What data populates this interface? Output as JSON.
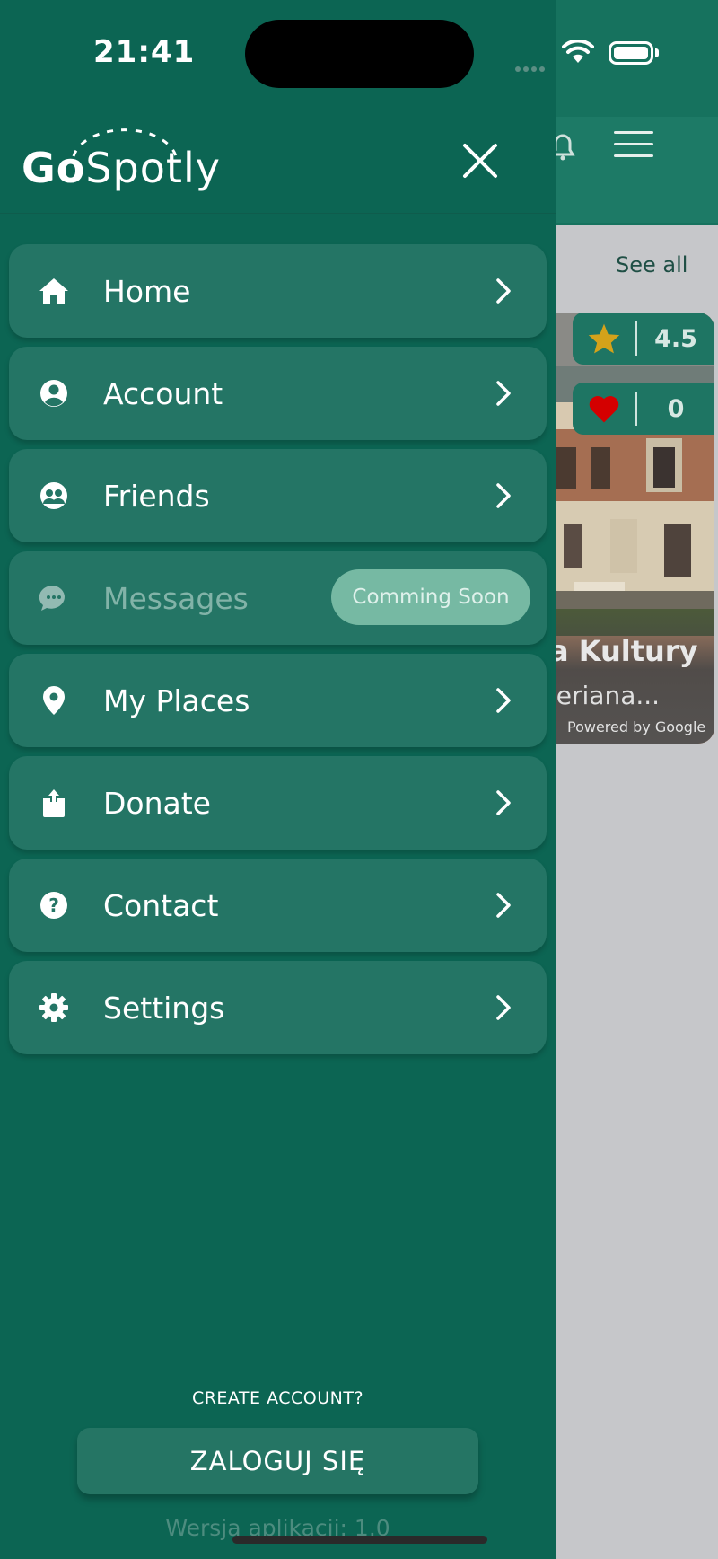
{
  "status_bar": {
    "time": "21:41"
  },
  "background_app": {
    "see_all": "See all",
    "card": {
      "rating": "4.5",
      "likes": "0",
      "title": "a Kultury",
      "subtitle": "leriana...",
      "attribution": "Powered by Google"
    }
  },
  "drawer": {
    "logo": {
      "part1": "Go",
      "part2": "Spotly"
    },
    "menu": [
      {
        "label": "Home",
        "icon": "home-icon"
      },
      {
        "label": "Account",
        "icon": "account-icon"
      },
      {
        "label": "Friends",
        "icon": "friends-icon"
      },
      {
        "label": "Messages",
        "icon": "messages-icon",
        "badge": "Comming Soon"
      },
      {
        "label": "My Places",
        "icon": "map-pin-icon"
      },
      {
        "label": "Donate",
        "icon": "share-icon"
      },
      {
        "label": "Contact",
        "icon": "help-icon"
      },
      {
        "label": "Settings",
        "icon": "gear-icon"
      }
    ],
    "create_account": "CREATE ACCOUNT?",
    "login_button": "ZALOGUJ SIĘ",
    "app_version": "Wersja aplikacji: 1.0"
  },
  "colors": {
    "drawer_bg": "#0c6553",
    "menu_item_bg": "#247565",
    "badge_bg": "#76b9a3",
    "star": "#d4a21a",
    "heart": "#d40000"
  }
}
